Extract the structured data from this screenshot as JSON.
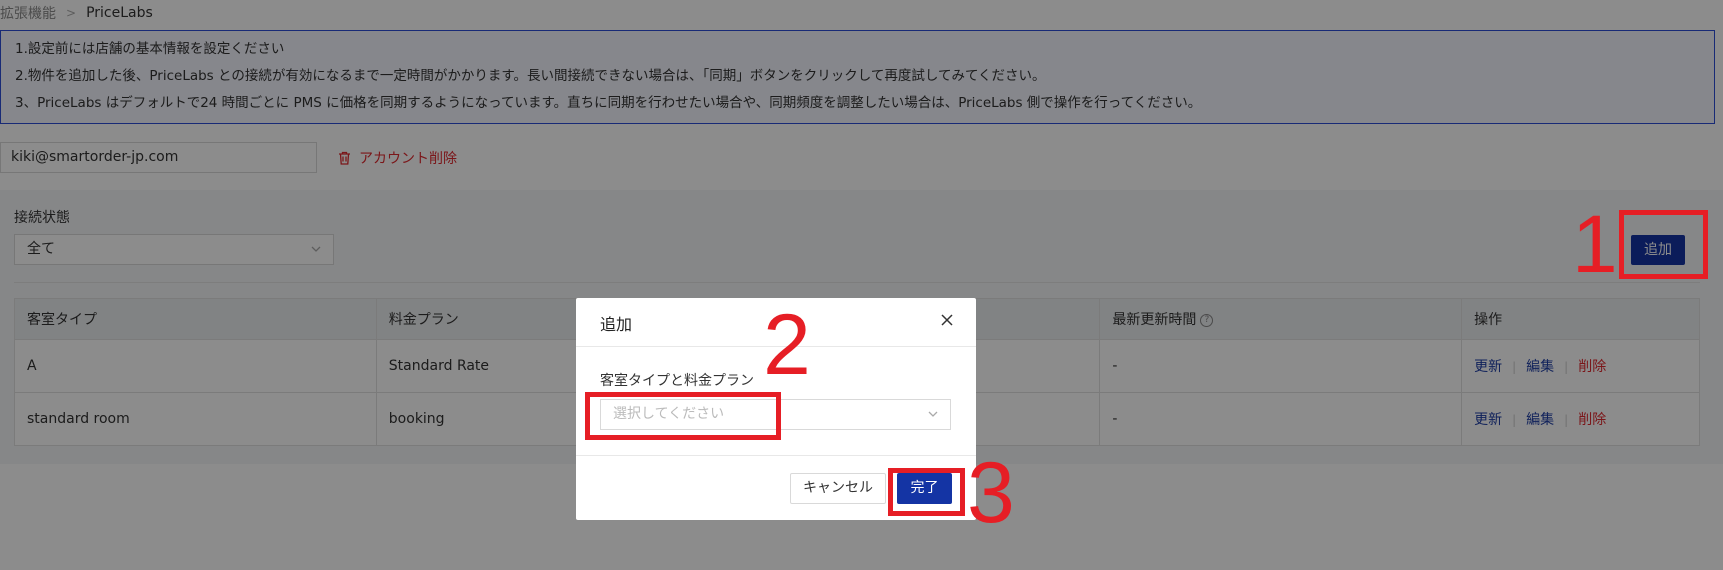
{
  "breadcrumb": {
    "parent": "拡張機能",
    "separator": ">",
    "current": "PriceLabs"
  },
  "notice": {
    "lines": [
      "1.設定前には店舗の基本情報を設定ください",
      "2.物件を追加した後、PriceLabs との接続が有効になるまで一定時間がかかります。長い間接続できない場合は、「同期」ボタンをクリックして再度試してみてください。",
      "3、PriceLabs はデフォルトで24 時間ごとに PMS に価格を同期するようになっています。直ちに同期を行わせたい場合や、同期頻度を調整したい場合は、PriceLabs 側で操作を行ってください。"
    ]
  },
  "account": {
    "email": "kiki@smartorder-jp.com",
    "delete_label": "アカウント削除"
  },
  "filter": {
    "label": "接続状態",
    "value": "全て"
  },
  "toolbar": {
    "add_label": "追加"
  },
  "table": {
    "headers": [
      "客室タイプ",
      "料金プラン",
      "",
      "最新更新時間",
      "操作"
    ],
    "rows": [
      {
        "room_type": "A",
        "rate_plan": "Standard Rate",
        "updated": "-"
      },
      {
        "room_type": "standard room",
        "rate_plan": "booking",
        "updated": "-"
      }
    ],
    "actions": {
      "update": "更新",
      "edit": "編集",
      "delete": "削除"
    }
  },
  "modal": {
    "title": "追加",
    "field_label": "客室タイプと料金プラン",
    "select_placeholder": "選択してください",
    "cancel_label": "キャンセル",
    "ok_label": "完了"
  },
  "annotations": {
    "step1": "1",
    "step2": "2",
    "step3": "3",
    "color": "#e61e25"
  },
  "colors": {
    "primary": "#1434a4",
    "danger": "#e0282e",
    "notice_border": "#2c4ed8"
  }
}
